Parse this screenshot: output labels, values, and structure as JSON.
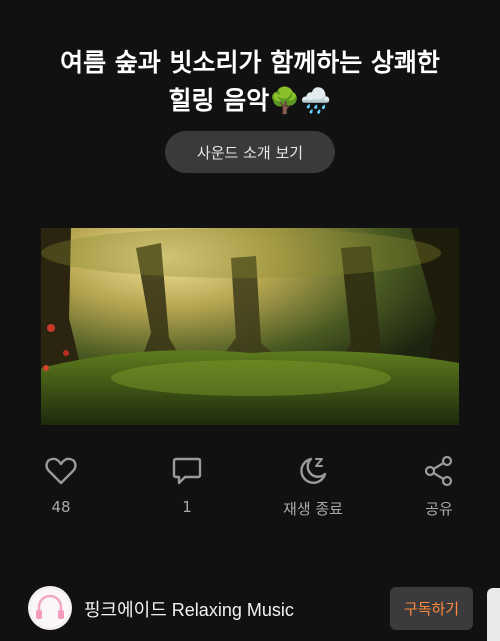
{
  "video": {
    "title_line1": "여름 숲과 빗소리가 함께하는 상쾌한",
    "title_line2": "힐링 음악",
    "title_emoji1": "🌳",
    "title_emoji2": "🌧️",
    "intro_button": "사운드 소개 보기",
    "thumbnail_icon": "forest-image"
  },
  "actions": {
    "like": {
      "icon": "heart-icon",
      "label": "48"
    },
    "comment": {
      "icon": "comment-icon",
      "label": "1"
    },
    "sleep": {
      "icon": "moon-sleep-icon",
      "label": "재생 종료"
    },
    "share": {
      "icon": "share-icon",
      "label": "공유"
    }
  },
  "channel": {
    "name": "핑크에이드 Relaxing Music",
    "subscribe_label": "구독하기",
    "subscribe_color": "#ff8a3d"
  }
}
